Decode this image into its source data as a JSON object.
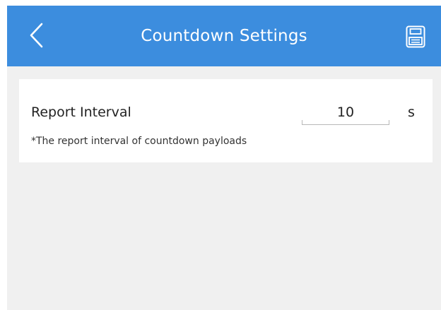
{
  "header": {
    "title": "Countdown Settings",
    "back_icon": "chevron-left-icon",
    "save_icon": "save-floppy-icon",
    "color": "#3c8dde"
  },
  "settings": {
    "report_interval": {
      "label": "Report Interval",
      "value": "10",
      "unit": "s",
      "hint": "*The report interval of countdown payloads"
    }
  },
  "colors": {
    "background": "#f0f0f0",
    "card": "#ffffff",
    "text": "#222222"
  }
}
